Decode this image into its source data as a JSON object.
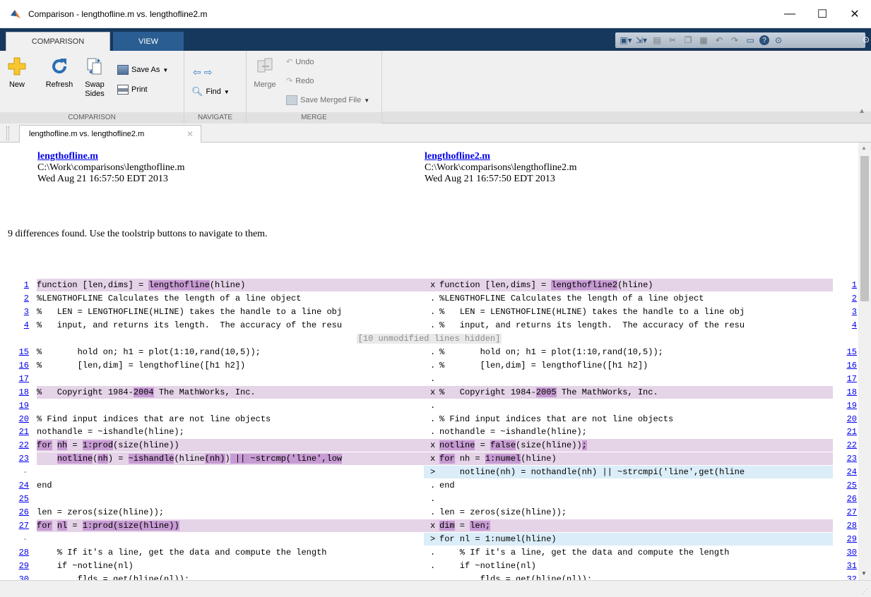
{
  "window": {
    "title": "Comparison - lengthofline.m vs. lengthofline2.m",
    "minimize": "—",
    "maximize": "☐",
    "close": "✕"
  },
  "ribbon_tabs": [
    "COMPARISON",
    "VIEW"
  ],
  "ribbon": {
    "comparison": {
      "label": "COMPARISON",
      "new": "New",
      "refresh": "Refresh",
      "swap": "Swap",
      "sides": "Sides",
      "save_as": "Save As",
      "print": "Print"
    },
    "navigate": {
      "label": "NAVIGATE",
      "find": "Find"
    },
    "merge": {
      "label": "MERGE",
      "merge": "Merge",
      "undo": "Undo",
      "redo": "Redo",
      "save_merged": "Save Merged File"
    }
  },
  "doc_tab": "lengthofline.m vs. lengthofline2.m",
  "left_file": {
    "name": "lengthofline.m",
    "path": "C:\\Work\\comparisons\\lengthofline.m",
    "date": "Wed Aug 21 16:57:50 EDT 2013"
  },
  "right_file": {
    "name": "lengthofline2.m",
    "path": "C:\\Work\\comparisons\\lengthofline2.m",
    "date": "Wed Aug 21 16:57:50 EDT 2013"
  },
  "summary": "9 differences found. Use the toolstrip buttons to navigate to them.",
  "hidden_text": "[10 unmodified lines hidden]",
  "colors": {
    "modified": "#e5d3e8",
    "inserted": "#daedf8",
    "highlight": "#c79bd3",
    "link": "#0000ee"
  },
  "lines": [
    {
      "l": "1",
      "r": "1",
      "m": "x",
      "type": "mod",
      "lc": [
        [
          "function [len,dims] = ",
          0
        ],
        [
          "lengthofline",
          1
        ],
        [
          "(hline)",
          0
        ]
      ],
      "rc": [
        [
          "function [len,dims] = ",
          0
        ],
        [
          "lengthofline2",
          1
        ],
        [
          "(hline)",
          0
        ]
      ]
    },
    {
      "l": "2",
      "r": "2",
      "m": ".",
      "type": "",
      "lc": [
        [
          "%LENGTHOFLINE Calculates the length of a line object",
          0
        ]
      ],
      "rc": [
        [
          "%LENGTHOFLINE Calculates the length of a line object",
          0
        ]
      ]
    },
    {
      "l": "3",
      "r": "3",
      "m": ".",
      "type": "",
      "lc": [
        [
          "%   LEN = LENGTHOFLINE(HLINE) takes the handle to a line obj",
          0
        ]
      ],
      "rc": [
        [
          "%   LEN = LENGTHOFLINE(HLINE) takes the handle to a line obj",
          0
        ]
      ]
    },
    {
      "l": "4",
      "r": "4",
      "m": ".",
      "type": "",
      "lc": [
        [
          "%   input, and returns its length.  The accuracy of the resu",
          0
        ]
      ],
      "rc": [
        [
          "%   input, and returns its length.  The accuracy of the resu",
          0
        ]
      ]
    },
    {
      "hidden": true
    },
    {
      "l": "15",
      "r": "15",
      "m": ".",
      "type": "",
      "lc": [
        [
          "%       hold on; h1 = plot(1:10,rand(10,5));",
          0
        ]
      ],
      "rc": [
        [
          "%       hold on; h1 = plot(1:10,rand(10,5));",
          0
        ]
      ]
    },
    {
      "l": "16",
      "r": "16",
      "m": ".",
      "type": "",
      "lc": [
        [
          "%       [len,dim] = lengthofline([h1 h2])",
          0
        ]
      ],
      "rc": [
        [
          "%       [len,dim] = lengthofline([h1 h2])",
          0
        ]
      ]
    },
    {
      "l": "17",
      "r": "17",
      "m": ".",
      "type": "",
      "lc": [],
      "rc": []
    },
    {
      "l": "18",
      "r": "18",
      "m": "x",
      "type": "mod",
      "lc": [
        [
          "%   Copyright 1984-",
          0
        ],
        [
          "2004",
          1
        ],
        [
          " The MathWorks, Inc.",
          0
        ]
      ],
      "rc": [
        [
          "%   Copyright 1984-",
          0
        ],
        [
          "2005",
          1
        ],
        [
          " The MathWorks, Inc.",
          0
        ]
      ]
    },
    {
      "l": "19",
      "r": "19",
      "m": ".",
      "type": "",
      "lc": [],
      "rc": []
    },
    {
      "l": "20",
      "r": "20",
      "m": ".",
      "type": "",
      "lc": [
        [
          "% Find input indices that are not line objects",
          0
        ]
      ],
      "rc": [
        [
          "% Find input indices that are not line objects",
          0
        ]
      ]
    },
    {
      "l": "21",
      "r": "21",
      "m": ".",
      "type": "",
      "lc": [
        [
          "nothandle = ~ishandle(hline);",
          0
        ]
      ],
      "rc": [
        [
          "nothandle = ~ishandle(hline);",
          0
        ]
      ]
    },
    {
      "l": "22",
      "r": "22",
      "m": "x",
      "type": "mod",
      "lc": [
        [
          "for",
          1
        ],
        [
          " ",
          0
        ],
        [
          "nh",
          1
        ],
        [
          " = ",
          0
        ],
        [
          "1:prod",
          1
        ],
        [
          "(size(hline))",
          0
        ]
      ],
      "rc": [
        [
          "notline",
          1
        ],
        [
          " = ",
          0
        ],
        [
          "false",
          1
        ],
        [
          "(size(hline))",
          0
        ],
        [
          ";",
          1
        ]
      ]
    },
    {
      "l": "23",
      "r": "23",
      "m": "x",
      "type": "mod",
      "lc": [
        [
          "    ",
          0
        ],
        [
          "notline",
          1
        ],
        [
          "(",
          0
        ],
        [
          "nh",
          1
        ],
        [
          ") = ",
          0
        ],
        [
          "~ishandle",
          1
        ],
        [
          "(hline",
          0
        ],
        [
          "(nh)",
          1
        ],
        [
          ")",
          0
        ],
        [
          " || ~strcmp('line',low",
          1
        ]
      ],
      "rc": [
        [
          "for",
          1
        ],
        [
          " nh = ",
          0
        ],
        [
          "1:numel",
          1
        ],
        [
          "(hline)",
          0
        ]
      ]
    },
    {
      "l": "-",
      "r": "24",
      "m": ">",
      "type": "ins",
      "lc": [],
      "rc": [
        [
          "    notline(nh) = nothandle(nh) || ~strcmpi('line',get(hline",
          0
        ]
      ]
    },
    {
      "l": "24",
      "r": "25",
      "m": ".",
      "type": "",
      "lc": [
        [
          "end",
          0
        ]
      ],
      "rc": [
        [
          "end",
          0
        ]
      ]
    },
    {
      "l": "25",
      "r": "26",
      "m": ".",
      "type": "",
      "lc": [],
      "rc": []
    },
    {
      "l": "26",
      "r": "27",
      "m": ".",
      "type": "",
      "lc": [
        [
          "len = zeros(size(hline));",
          0
        ]
      ],
      "rc": [
        [
          "len = zeros(size(hline));",
          0
        ]
      ]
    },
    {
      "l": "27",
      "r": "28",
      "m": "x",
      "type": "mod",
      "lc": [
        [
          "for",
          1
        ],
        [
          " ",
          0
        ],
        [
          "nl",
          1
        ],
        [
          " = ",
          0
        ],
        [
          "1:prod(size(hline))",
          1
        ]
      ],
      "rc": [
        [
          "dim",
          1
        ],
        [
          " = ",
          0
        ],
        [
          "len;",
          1
        ]
      ]
    },
    {
      "l": "-",
      "r": "29",
      "m": ">",
      "type": "ins",
      "lc": [],
      "rc": [
        [
          "for nl = 1:numel(hline)",
          0
        ]
      ]
    },
    {
      "l": "28",
      "r": "30",
      "m": ".",
      "type": "",
      "lc": [
        [
          "    % If it's a line, get the data and compute the length",
          0
        ]
      ],
      "rc": [
        [
          "    % If it's a line, get the data and compute the length",
          0
        ]
      ]
    },
    {
      "l": "29",
      "r": "31",
      "m": ".",
      "type": "",
      "lc": [
        [
          "    if ~notline(nl)",
          0
        ]
      ],
      "rc": [
        [
          "    if ~notline(nl)",
          0
        ]
      ]
    },
    {
      "l": "30",
      "r": "32",
      "m": ".",
      "type": "",
      "lc": [
        [
          "        flds = get(hline(nl));",
          0
        ]
      ],
      "rc": [
        [
          "        flds = get(hline(nl));",
          0
        ]
      ]
    }
  ]
}
